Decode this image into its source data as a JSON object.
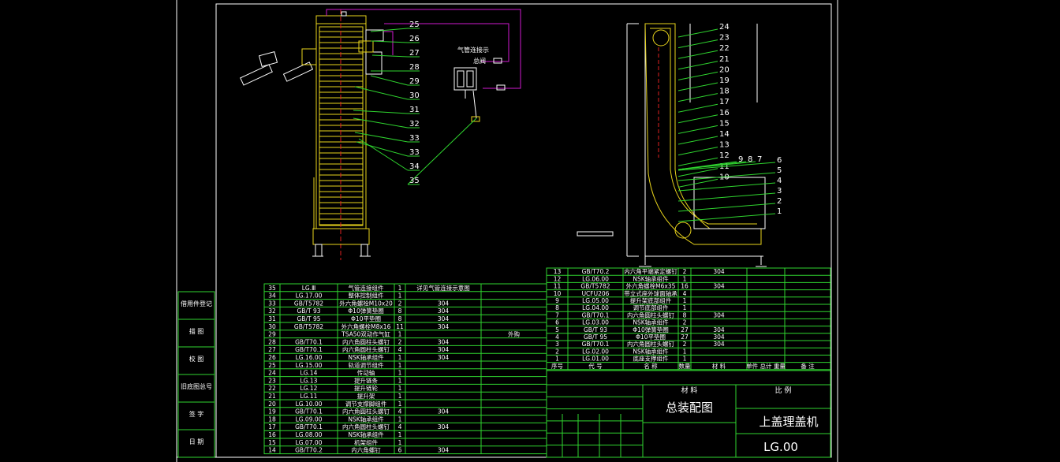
{
  "colors": {
    "background": "#000000",
    "frame": "#ffffff",
    "table": "#2fd52f",
    "machine": "#e8d41c",
    "air": "#d01ad0",
    "frame_red": "#e02020"
  },
  "front_callouts": [
    "25",
    "26",
    "27",
    "28",
    "29",
    "30",
    "31",
    "32",
    "33",
    "33",
    "34",
    "35"
  ],
  "side_callouts": [
    "24",
    "23",
    "22",
    "21",
    "20",
    "19",
    "18",
    "17",
    "16",
    "15",
    "14",
    "13",
    "12",
    "11",
    "10",
    "9",
    "8",
    "7",
    "6",
    "5",
    "4",
    "3",
    "2",
    "1"
  ],
  "air_labels": {
    "source": "气管连接示",
    "valve": "总阀"
  },
  "side_labels": [
    "借用件登记",
    "描 图",
    "校 图",
    "旧底图总号",
    "签 字",
    "日 期"
  ],
  "left_bom": [
    [
      "35",
      "LG.Ⅲ",
      "气管连接组件",
      "1",
      "详见气管连接示意图",
      ""
    ],
    [
      "34",
      "LG.17.00",
      "整体控制组件",
      "1",
      "",
      ""
    ],
    [
      "33",
      "GB/T5782",
      "外六角螺栓M10x20",
      "2",
      "304",
      ""
    ],
    [
      "32",
      "GB/T 93",
      "Φ10弹簧垫圈",
      "8",
      "304",
      ""
    ],
    [
      "31",
      "GB/T 95",
      "Φ10平垫圈",
      "8",
      "304",
      ""
    ],
    [
      "30",
      "GB/T5782",
      "外六角螺栓M8x16",
      "11",
      "304",
      ""
    ],
    [
      "29",
      "",
      "TSA50双动作气缸",
      "1",
      "",
      "外购"
    ],
    [
      "28",
      "GB/T70.1",
      "内六角圆柱头螺钉",
      "2",
      "304",
      ""
    ],
    [
      "27",
      "GB/T70.1",
      "内六角圆柱头螺钉",
      "4",
      "304",
      ""
    ],
    [
      "26",
      "LG.16.00",
      "NSK轴承组件",
      "1",
      "304",
      ""
    ],
    [
      "25",
      "LG.15.00",
      "轨道调节组件",
      "1",
      "",
      ""
    ],
    [
      "24",
      "LG.14",
      "传动轴",
      "1",
      "",
      ""
    ],
    [
      "23",
      "LG.13",
      "提升链条",
      "1",
      "",
      ""
    ],
    [
      "22",
      "LG.12",
      "提升链轮",
      "1",
      "",
      ""
    ],
    [
      "21",
      "LG.11",
      "提升架",
      "1",
      "",
      ""
    ],
    [
      "20",
      "LG.10.00",
      "调节支撑脚组件",
      "1",
      "",
      ""
    ],
    [
      "19",
      "GB/T70.1",
      "内六角圆柱头螺钉",
      "4",
      "304",
      ""
    ],
    [
      "18",
      "LG.09.00",
      "NSK轴承组件",
      "1",
      "",
      ""
    ],
    [
      "17",
      "GB/T70.1",
      "内六角圆柱头螺钉",
      "4",
      "304",
      ""
    ],
    [
      "16",
      "LG.08.00",
      "NSK轴承组件",
      "1",
      "",
      ""
    ],
    [
      "15",
      "LG.07.00",
      "机架组件",
      "1",
      "",
      ""
    ],
    [
      "14",
      "GB/T70.2",
      "内六角螺钉",
      "6",
      "304",
      ""
    ]
  ],
  "right_bom": [
    [
      "13",
      "GB/T70.2",
      "内六角平端紧定螺钉",
      "2",
      "304",
      ""
    ],
    [
      "12",
      "LG.06.00",
      "NSK轴承组件",
      "1",
      "",
      ""
    ],
    [
      "11",
      "GB/T5782",
      "外六角螺栓M6x35",
      "16",
      "304",
      ""
    ],
    [
      "10",
      "UCFU206",
      "带立式座外球面轴承",
      "4",
      "",
      ""
    ],
    [
      "9",
      "LG.05.00",
      "提升架底部组件",
      "1",
      "",
      ""
    ],
    [
      "8",
      "LG.04.00",
      "调节底部组件",
      "1",
      "",
      ""
    ],
    [
      "7",
      "GB/T70.1",
      "内六角圆柱头螺钉",
      "8",
      "304",
      ""
    ],
    [
      "6",
      "LG.03.00",
      "NSK轴承组件",
      "2",
      "",
      ""
    ],
    [
      "5",
      "GB/T 93",
      "Φ10弹簧垫圈",
      "27",
      "304",
      ""
    ],
    [
      "4",
      "GB/T 95",
      "Φ10平垫圈",
      "27",
      "304",
      ""
    ],
    [
      "3",
      "GB/T70.1",
      "内六角圆柱头螺钉",
      "2",
      "304",
      ""
    ],
    [
      "2",
      "LG.02.00",
      "NSK轴承组件",
      "1",
      "",
      ""
    ],
    [
      "1",
      "LG.01.00",
      "底座支撑组件",
      "1",
      "",
      ""
    ]
  ],
  "bom_header": [
    "序号",
    "代 号",
    "名 称",
    "数量",
    "材 料",
    "单件 总计 重量",
    "备 注"
  ],
  "title_block": {
    "drawing_title": "总装配图",
    "product": "上盖理盖机",
    "drawing_no": "LG.00",
    "material_label": "材 料",
    "scale_label": "比 例"
  }
}
